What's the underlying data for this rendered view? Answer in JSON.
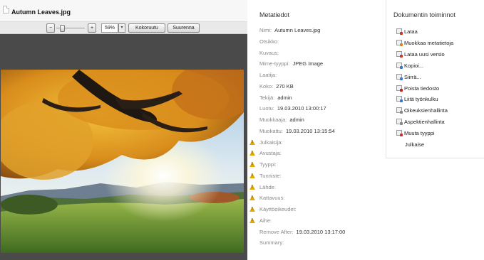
{
  "document": {
    "title": "Autumn Leaves.jpg"
  },
  "toolbar": {
    "zoom_out": "−",
    "zoom_in": "+",
    "zoom_value": "59%",
    "dropdown": "▾",
    "fit_label": "Kokoruutu",
    "enlarge_label": "Suurenna"
  },
  "metadata": {
    "title": "Metatiedot",
    "rows": [
      {
        "label": "Nimi:",
        "value": "Autumn Leaves.jpg",
        "warn": false
      },
      {
        "label": "Otsikko:",
        "value": "",
        "warn": false
      },
      {
        "label": "Kuvaus:",
        "value": "",
        "warn": false
      },
      {
        "label": "Mime-tyyppi:",
        "value": "JPEG Image",
        "warn": false
      },
      {
        "label": "Laatija:",
        "value": "",
        "warn": false
      },
      {
        "label": "Koko:",
        "value": "270 KB",
        "warn": false
      },
      {
        "label": "Tekijä:",
        "value": "admin",
        "warn": false
      },
      {
        "label": "Luotu:",
        "value": "19.03.2010 13:00:17",
        "warn": false
      },
      {
        "label": "Muokkaaja:",
        "value": "admin",
        "warn": false
      },
      {
        "label": "Muokattu:",
        "value": "19.03.2010 13:15:54",
        "warn": false
      },
      {
        "label": "Julkaisija:",
        "value": "",
        "warn": true
      },
      {
        "label": "Avustaja:",
        "value": "",
        "warn": true
      },
      {
        "label": "Tyyppi:",
        "value": "",
        "warn": true
      },
      {
        "label": "Tunniste:",
        "value": "",
        "warn": true
      },
      {
        "label": "Lähde:",
        "value": "",
        "warn": true
      },
      {
        "label": "Kattavuus:",
        "value": "",
        "warn": true
      },
      {
        "label": "Käyttöoikeudet:",
        "value": "",
        "warn": true
      },
      {
        "label": "Aihe:",
        "value": "",
        "warn": true
      },
      {
        "label": "Remove After:",
        "value": "19.03.2010 13:17:00",
        "warn": false
      },
      {
        "label": "Summary:",
        "value": "",
        "warn": false
      }
    ]
  },
  "actions": {
    "title": "Dokumentin toiminnot",
    "items": [
      {
        "label": "Lataa",
        "icon": "download-icon",
        "color": "#d03030"
      },
      {
        "label": "Muokkaa metatietoja",
        "icon": "edit-metadata-icon",
        "color": "#d08a20"
      },
      {
        "label": "Lataa uusi versio",
        "icon": "upload-version-icon",
        "color": "#d03030"
      },
      {
        "label": "Kopioi...",
        "icon": "copy-icon",
        "color": "#3a78c8"
      },
      {
        "label": "Siirrä...",
        "icon": "move-icon",
        "color": "#3a78c8"
      },
      {
        "label": "Poista tiedosto",
        "icon": "delete-icon",
        "color": "#c82020"
      },
      {
        "label": "Liitä työnkulku",
        "icon": "workflow-icon",
        "color": "#3a78c8"
      },
      {
        "label": "Oikeuksienhallinta",
        "icon": "permissions-icon",
        "color": "#888888"
      },
      {
        "label": "Aspektienhallinta",
        "icon": "aspects-icon",
        "color": "#888888"
      },
      {
        "label": "Muuta tyyppi",
        "icon": "change-type-icon",
        "color": "#d03030"
      },
      {
        "label": "Julkaise",
        "icon": "",
        "color": ""
      }
    ]
  }
}
